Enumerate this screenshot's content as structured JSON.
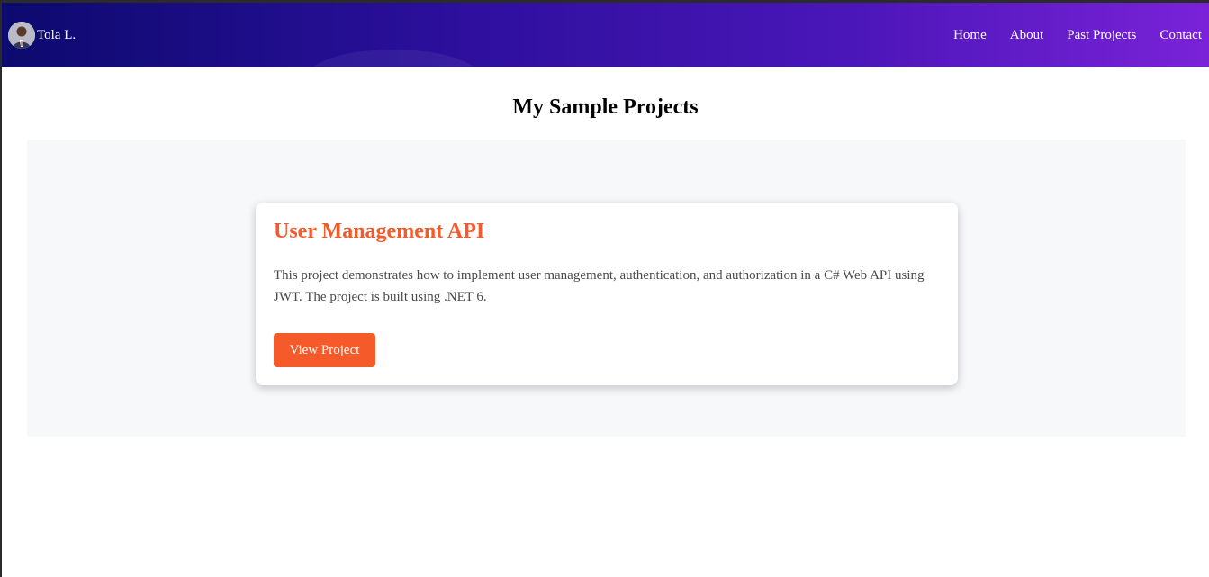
{
  "navbar": {
    "brand_name": "Tola L.",
    "links": [
      "Home",
      "About",
      "Past Projects",
      "Contact"
    ],
    "gradient_colors": [
      "#0c0a6e",
      "#7a22d8"
    ]
  },
  "main": {
    "title": "My Sample Projects",
    "projects": [
      {
        "title": "User Management API",
        "description": "This project demonstrates how to implement user management, authentication, and authorization in a C# Web API using JWT. The project is built using .NET 6.",
        "button_label": "View Project"
      }
    ]
  },
  "colors": {
    "accent": "#f55a2b",
    "section_background": "#f7f8fa"
  }
}
